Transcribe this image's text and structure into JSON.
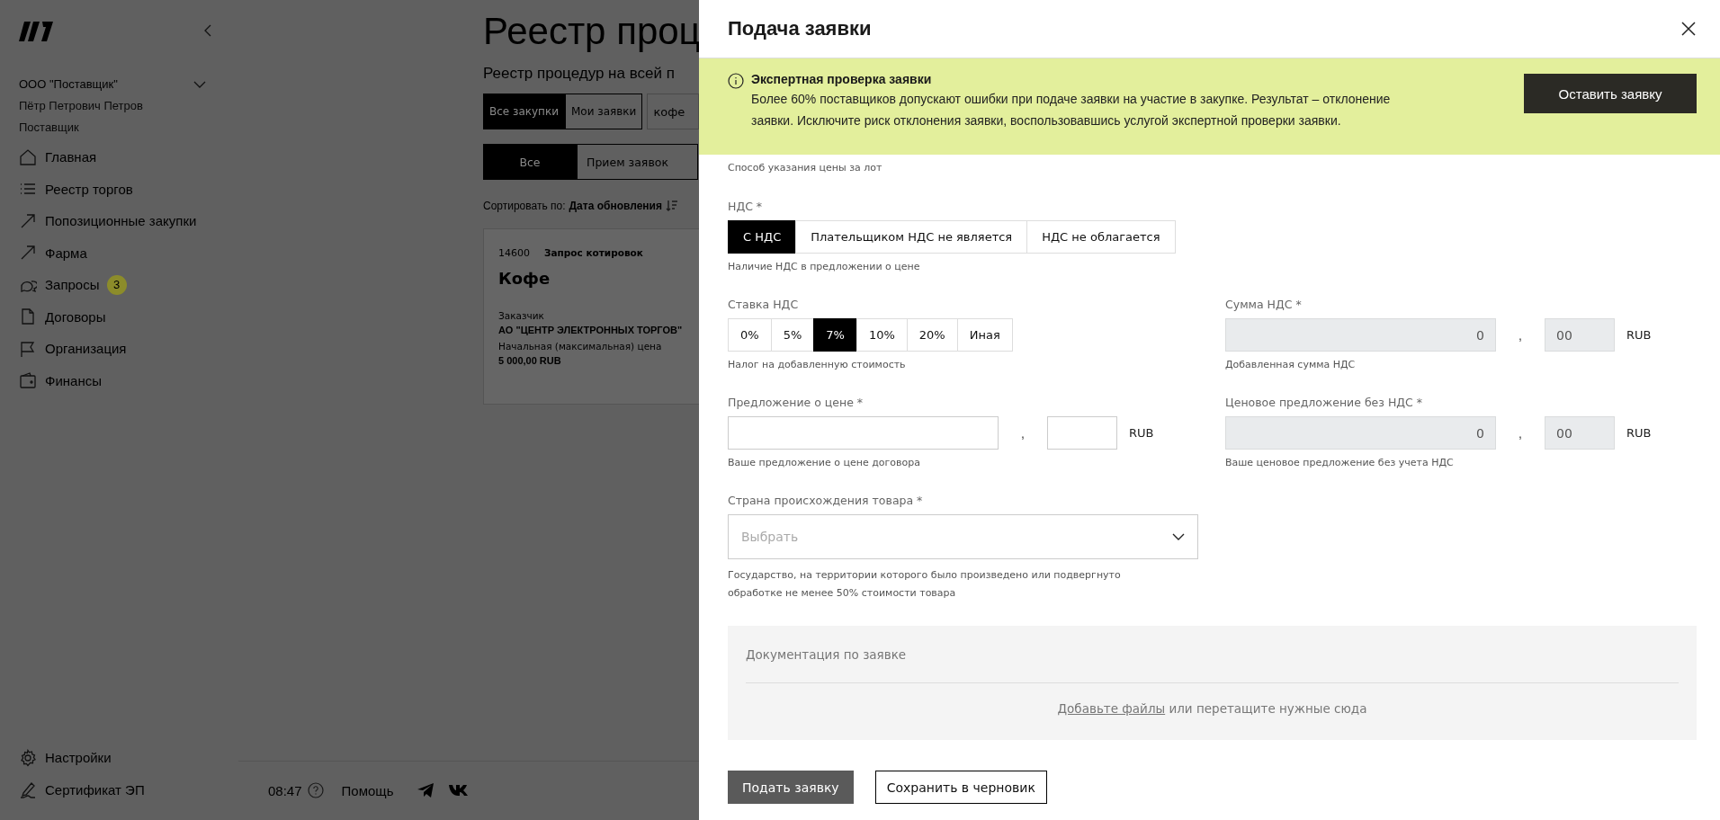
{
  "sidebar": {
    "account": {
      "organization": "ООО \"Поставщик\"",
      "user": "Пётр Петрович Петров",
      "role": "Поставщик"
    },
    "nav": [
      {
        "label": "Главная"
      },
      {
        "label": "Реестр торгов"
      },
      {
        "label": "Попозиционные закупки"
      },
      {
        "label": "Фарма"
      },
      {
        "label": "Запросы",
        "badge": "3"
      },
      {
        "label": "Договоры"
      },
      {
        "label": "Организация"
      },
      {
        "label": "Финансы"
      }
    ],
    "bottom": [
      {
        "label": "Настройки"
      },
      {
        "label": "Сертификат ЭП"
      }
    ]
  },
  "main": {
    "title": "Реестр проц",
    "subtitle": "Реестр процедур на всей п",
    "tabs": [
      {
        "label": "Все закупки",
        "selected": true
      },
      {
        "label": "Мои заявки",
        "selected": false
      }
    ],
    "search": {
      "value": "кофе"
    },
    "filters": [
      {
        "label": "Все",
        "selected": true
      },
      {
        "label": "Прием заявок",
        "selected": false
      }
    ],
    "sort": {
      "label": "Сортировать по:",
      "value": "Дата обновления"
    },
    "card": {
      "number": "14600",
      "type": "Запрос котировок",
      "title": "Кофе",
      "customer_label": "Заказчик",
      "customer": "АО \"ЦЕНТР ЭЛЕКТРОННЫХ ТОРГОВ\"",
      "price_label": "Начальная (максимальная) цена",
      "price": "5 000,00 RUB"
    },
    "footer": {
      "time": "08:47",
      "help": "Помощь"
    }
  },
  "modal": {
    "title": "Подача заявки",
    "banner": {
      "title": "Экспертная проверка заявки",
      "text": "Более 60% поставщиков допускают ошибки при подаче заявки на участие в закупке. Результат – отклонение заявки. Исключите риск отклонения заявки, воспользовавшись услугой экспертной проверки заявки.",
      "button": "Оставить заявку"
    },
    "scrolled_hint": "Способ указания цены за лот",
    "vat": {
      "label": "НДС *",
      "hint": "Наличие НДС в предложении о цене",
      "options": [
        {
          "label": "С НДС",
          "selected": true
        },
        {
          "label": "Плательщиком НДС не является",
          "selected": false
        },
        {
          "label": "НДС не облагается",
          "selected": false
        }
      ]
    },
    "vat_rate": {
      "label": "Ставка НДС",
      "hint": "Налог на добавленную стоимость",
      "options": [
        {
          "label": "0%",
          "selected": false
        },
        {
          "label": "5%",
          "selected": false
        },
        {
          "label": "7%",
          "selected": true
        },
        {
          "label": "10%",
          "selected": false
        },
        {
          "label": "20%",
          "selected": false
        },
        {
          "label": "Иная",
          "selected": false
        }
      ]
    },
    "vat_amount": {
      "label": "Сумма НДС *",
      "value": "0",
      "cents": "00",
      "separator": ",",
      "currency": "RUB",
      "disabled": true,
      "hint": "Добавленная сумма НДС"
    },
    "price": {
      "label": "Предложение о цене *",
      "separator": ",",
      "currency": "RUB",
      "disabled": false,
      "hint": "Ваше предложение о цене договора"
    },
    "price_without_vat": {
      "label": "Ценовое предложение без НДС *",
      "value": "0",
      "cents": "00",
      "separator": ",",
      "currency": "RUB",
      "disabled": true,
      "hint": "Ваше ценовое предложение без учета НДС"
    },
    "country": {
      "label": "Страна происхождения товара *",
      "placeholder": "Выбрать",
      "hint": "Государство, на территории которого было произведено или подвергнуто обработке не менее 50% стоимости товара"
    },
    "documents": {
      "title": "Документация по заявке",
      "link": "Добавьте файлы",
      "text": " или перетащите нужные сюда"
    },
    "buttons": {
      "submit": "Подать заявку",
      "draft": "Сохранить в черновик"
    }
  }
}
